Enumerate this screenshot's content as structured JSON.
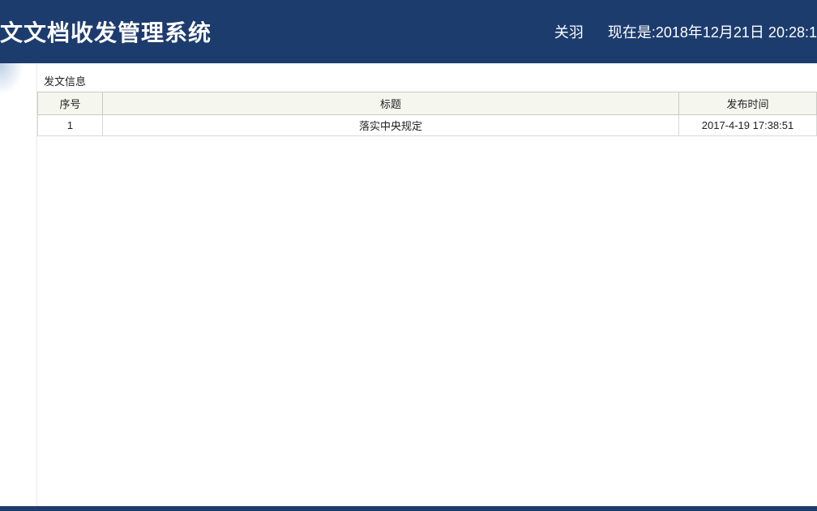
{
  "header": {
    "title": "文文档收发管理系统",
    "user": "关羽",
    "now_label": "现在是:",
    "now_time": "2018年12月21日 20:28:1"
  },
  "panel": {
    "title": "发文信息"
  },
  "table": {
    "columns": {
      "seq": "序号",
      "title": "标题",
      "time": "发布时间"
    },
    "rows": [
      {
        "seq": "1",
        "title": "落实中央规定",
        "time": "2017-4-19 17:38:51"
      }
    ]
  }
}
